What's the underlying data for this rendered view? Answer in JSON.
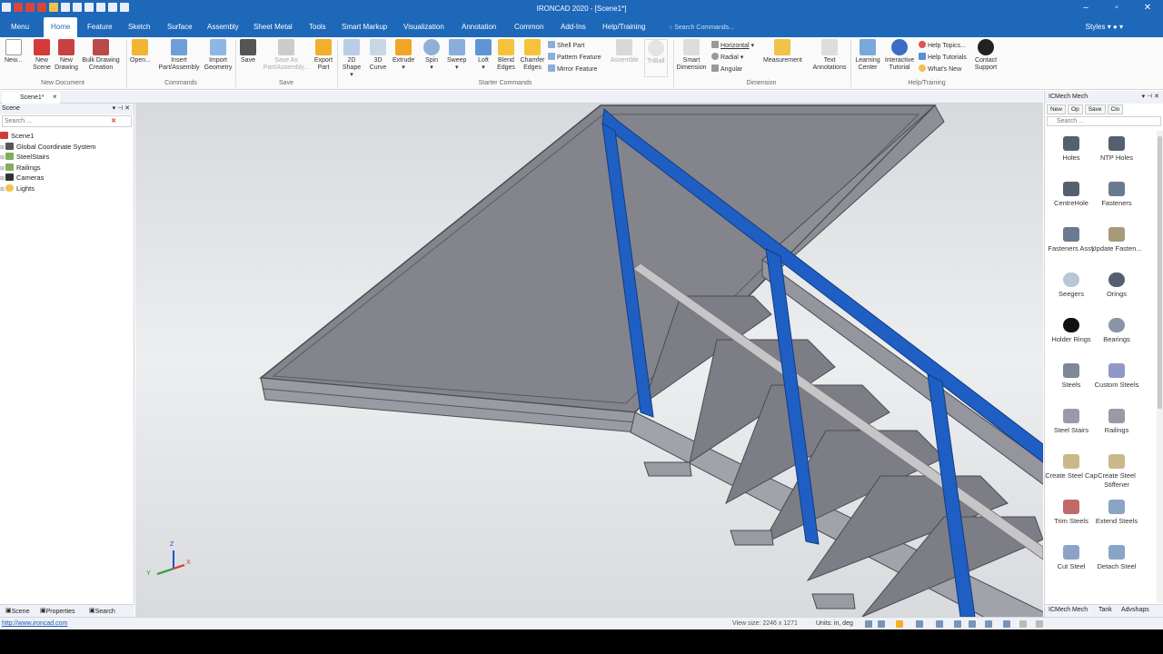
{
  "app": {
    "title": "IRONCAD 2020 - [Scene1*]"
  },
  "menu_tabs": [
    "Menu",
    "Home",
    "Feature",
    "Sketch",
    "Surface",
    "Assembly",
    "Sheet Metal",
    "Tools",
    "Smart Markup",
    "Visualization",
    "Annotation",
    "Common",
    "Add-Ins",
    "Help/Training"
  ],
  "active_tab": "Home",
  "search_commands": {
    "placeholder": "Search Commands..."
  },
  "styles_label": "Styles",
  "ribbon": {
    "new_document": {
      "label": "New Document",
      "buttons": [
        "New...",
        "New Scene",
        "New Drawing",
        "Bulk Drawing Creation"
      ]
    },
    "commands": {
      "label": "Commands",
      "buttons": [
        "Open...",
        "Insert Part/Assembly",
        "Import Geometry"
      ]
    },
    "save": {
      "label": "Save",
      "buttons": [
        "Save",
        "Save As Part/Assembly...",
        "Export Part"
      ]
    },
    "starter": {
      "label": "Starter Commands",
      "buttons": [
        "2D Shape",
        "3D Curve",
        "Extrude",
        "Spin",
        "Sweep",
        "Loft",
        "Blend Edges",
        "Chamfer Edges"
      ],
      "small": [
        "Shell Part",
        "Pattern Feature",
        "Mirror Feature"
      ],
      "disabled": [
        "Assemble",
        "TriBall"
      ]
    },
    "dimension": {
      "label": "Dimension",
      "buttons": [
        "Smart Dimension",
        "Measurement",
        "Text Annotations"
      ],
      "small": [
        "Horizontal",
        "Radial",
        "Angular"
      ]
    },
    "help": {
      "label": "Help/Training",
      "buttons": [
        "Learning Center",
        "Interactive Tutorial",
        "Contact Support"
      ],
      "small": [
        "Help Topics...",
        "Help Tutorials",
        "What's New"
      ]
    }
  },
  "doc_tab": "Scene1*",
  "scene_panel": {
    "title": "Scene",
    "search_placeholder": "Search ...",
    "tree": [
      "Scene1",
      "Global Coordinate System",
      "SteelStairs",
      "Railings",
      "Cameras",
      "Lights"
    ],
    "bottom_tabs": [
      "Scene",
      "Properties",
      "Search"
    ]
  },
  "catalog_panel": {
    "title": "ICMech Mech",
    "toolbar": [
      "New",
      "Op",
      "Save",
      "Clo"
    ],
    "search_placeholder": "Search ...",
    "items": [
      "Holes",
      "NTP Holes",
      "CentreHole",
      "Fasteners",
      "Fasteners Assy",
      "Update Fasten...",
      "Seegers",
      "Orings",
      "Holder Rings",
      "Bearings",
      "Steels",
      "Custom Steels",
      "Steel Stairs",
      "Railings",
      "Create Steel Cap",
      "Create Steel Stiffener",
      "Trim Steels",
      "Extend Steels",
      "Cut Steel",
      "Detach Steel"
    ],
    "bottom_tabs": [
      "ICMech Mech",
      "Tank",
      "Advshaps"
    ]
  },
  "axis_labels": {
    "z": "Z",
    "y": "Y",
    "x": "X"
  },
  "status": {
    "link": "http://www.ironcad.com",
    "view_size": "View size: 2246 x 1271",
    "units": "Units:  in, deg"
  },
  "colors": {
    "brand": "#1d68b9",
    "railing_blue": "#1f5fc4",
    "steel": "#8a8a92",
    "handrail": "#c8c8c8"
  }
}
